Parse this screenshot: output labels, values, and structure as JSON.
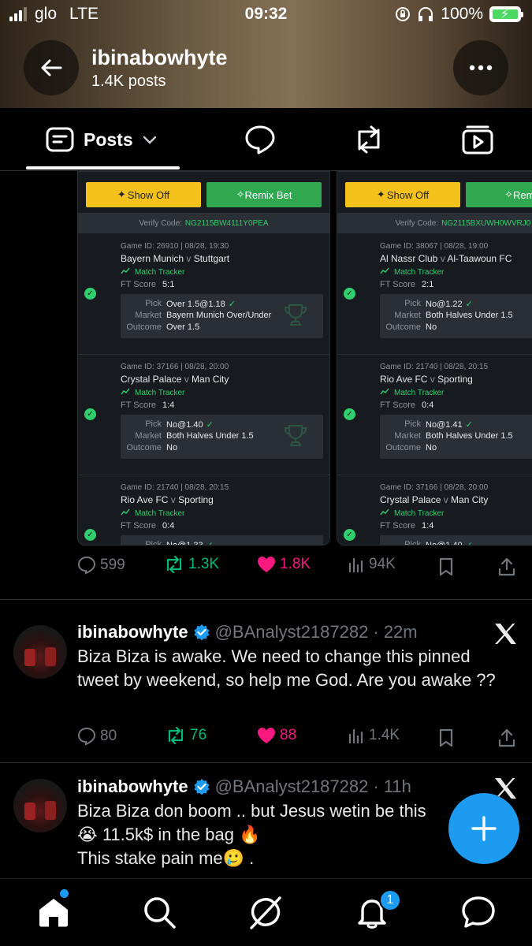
{
  "status_bar": {
    "carrier": "glo",
    "network": "LTE",
    "time": "09:32",
    "battery": "100%"
  },
  "header": {
    "title": "ibinabowhyte",
    "subtitle": "1.4K posts"
  },
  "tabs": {
    "posts_label": "Posts"
  },
  "bet_cards": [
    {
      "show_off": "Show Off",
      "remix": "Remix Bet",
      "verify_label": "Verify Code:",
      "verify_code": "NG2115BW4111Y0PEA",
      "games": [
        {
          "meta": "Game ID: 26910 | 08/28, 19:30",
          "home": "Bayern Munich",
          "away": "Stuttgart",
          "tracker": "Match Tracker",
          "ft_label": "FT Score",
          "ft": "5:1",
          "pick_label": "Pick",
          "pick": "Over 1.5@1.18",
          "market_label": "Market",
          "market": "Bayern Munich Over/Under",
          "outcome_label": "Outcome",
          "outcome": "Over 1.5"
        },
        {
          "meta": "Game ID: 37166 | 08/28, 20:00",
          "home": "Crystal Palace",
          "away": "Man City",
          "tracker": "Match Tracker",
          "ft_label": "FT Score",
          "ft": "1:4",
          "pick_label": "Pick",
          "pick": "No@1.40",
          "market_label": "Market",
          "market": "Both Halves Under 1.5",
          "outcome_label": "Outcome",
          "outcome": "No"
        },
        {
          "meta": "Game ID: 21740 | 08/28, 20:15",
          "home": "Rio Ave FC",
          "away": "Sporting",
          "tracker": "Match Tracker",
          "ft_label": "FT Score",
          "ft": "0:4",
          "pick_label": "Pick",
          "pick": "No@1.33",
          "market_label": "",
          "market": "",
          "outcome_label": "",
          "outcome": ""
        }
      ]
    },
    {
      "show_off": "Show Off",
      "remix": "Remix",
      "verify_label": "Verify Code:",
      "verify_code": "NG2115BXUWH0WVRJ0",
      "games": [
        {
          "meta": "Game ID: 38067 | 08/28, 19:00",
          "home": "Al Nassr Club",
          "away": "Al-Taawoun FC",
          "tracker": "Match Tracker",
          "ft_label": "FT Score",
          "ft": "2:1",
          "pick_label": "Pick",
          "pick": "No@1.22",
          "market_label": "Market",
          "market": "Both Halves Under 1.5",
          "outcome_label": "Outcome",
          "outcome": "No"
        },
        {
          "meta": "Game ID: 21740 | 08/28, 20:15",
          "home": "Rio Ave FC",
          "away": "Sporting",
          "tracker": "Match Tracker",
          "ft_label": "FT Score",
          "ft": "0:4",
          "pick_label": "Pick",
          "pick": "No@1.41",
          "market_label": "Market",
          "market": "Both Halves Under 1.5",
          "outcome_label": "Outcome",
          "outcome": "No"
        },
        {
          "meta": "Game ID: 37166 | 08/28, 20:00",
          "home": "Crystal Palace",
          "away": "Man City",
          "tracker": "Match Tracker",
          "ft_label": "FT Score",
          "ft": "1:4",
          "pick_label": "Pick",
          "pick": "No@1.40",
          "market_label": "",
          "market": "",
          "outcome_label": "",
          "outcome": ""
        }
      ]
    }
  ],
  "post1_engagement": {
    "replies": "599",
    "reposts": "1.3K",
    "likes": "1.8K",
    "views": "94K"
  },
  "tweets": [
    {
      "name": "ibinabowhyte",
      "handle": "@BAnalyst2187282",
      "time": "· 22m",
      "text": "Biza Biza is awake. We need to change this pinned tweet by weekend, so help me God. Are you awake ??",
      "replies": "80",
      "reposts": "76",
      "likes": "88",
      "views": "1.4K"
    },
    {
      "name": "ibinabowhyte",
      "handle": "@BAnalyst2187282",
      "time": "· 11h",
      "line1": "Biza Biza don boom .. but Jesus wetin be this",
      "line2": "😭 11.5k$ in the bag 🔥",
      "line3": "This stake pain me🥲 ."
    }
  ],
  "notifications_badge": "1",
  "colors": {
    "accent": "#1d9bf0",
    "repost": "#00ba7c",
    "like": "#f91880",
    "show_off": "#f5c21c",
    "remix": "#2fa84f"
  }
}
